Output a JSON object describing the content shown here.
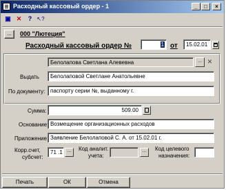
{
  "window": {
    "title": "Расходный кассовый ордер - 1"
  },
  "title_buttons": {
    "minimize": "_",
    "maximize": "□",
    "close": "×"
  },
  "toolbar": [
    {
      "name": "save-toolbar-icon",
      "glyph": "▣",
      "color": "#0000a0"
    },
    {
      "name": "delete-toolbar-icon",
      "glyph": "✕",
      "color": "#c00000"
    },
    {
      "name": "help-toolbar-icon",
      "glyph": "?",
      "color": "#000080"
    },
    {
      "name": "help-pointer-toolbar-icon",
      "glyph": "↖?",
      "color": "#000080"
    }
  ],
  "header": {
    "org_button": "...",
    "org_name": "000 \"Лютеция\"",
    "doc_title": "Расходный кассовый ордер №",
    "number": "1",
    "date_prefix": "от",
    "date": "15.02.01"
  },
  "recipient": {
    "name": "Белолапова Светлана Алевевна",
    "pick_button": "...",
    "clear_button": "×"
  },
  "fields": {
    "issue_label": "Выдать",
    "issue_value": "Белолаповой Светлане Анатольевне",
    "doc_label": "По документу:",
    "doc_value": "паспорту серии  №, выданному  г.",
    "sum_label": "Сумма:",
    "sum_value": "509.00",
    "basis_label": "Основание:",
    "basis_value": "Возмещение организационных расходов",
    "attach_label": "Приложение:",
    "attach_value": "Заявление Белолаповой С. А. от 15.02.01 г."
  },
  "accounts": {
    "corr_label_1": "Корр.счет,",
    "corr_label_2": "субсчет:",
    "corr_value": "71 .1",
    "corr_button": "...",
    "analytic_label_1": "Код аналит.",
    "analytic_label_2": "учета:",
    "analytic_value": "",
    "analytic_button": "...",
    "target_label_1": "Код целевого",
    "target_label_2": "назначения:",
    "target_value": ""
  },
  "buttons": {
    "print": "Печать",
    "ok": "ОК",
    "cancel": "Отмена"
  }
}
